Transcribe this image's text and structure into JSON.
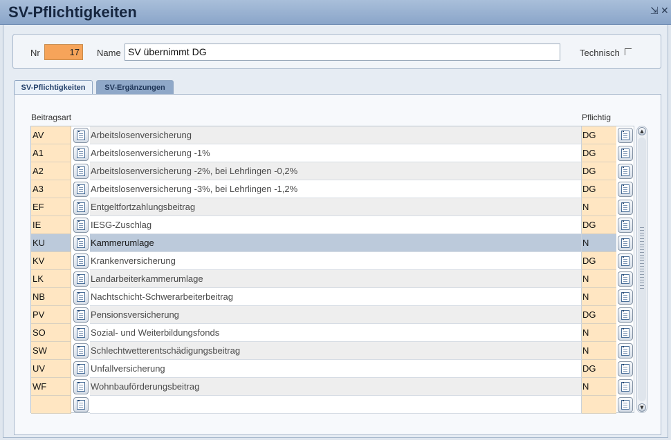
{
  "window": {
    "title": "SV-Pflichtigkeiten",
    "pin_glyph": "⇲",
    "close_glyph": "✕"
  },
  "header": {
    "nr_label": "Nr",
    "nr_value": "17",
    "name_label": "Name",
    "name_value": "SV übernimmt DG",
    "technisch_label": "Technisch",
    "technisch_checked": false
  },
  "tabs": [
    {
      "label": "SV-Pflichtigkeiten",
      "active": true
    },
    {
      "label": "SV-Ergänzungen",
      "active": false
    }
  ],
  "grid": {
    "col_beitragsart": "Beitragsart",
    "col_pflichtig": "Pflichtig",
    "rows": [
      {
        "code": "AV",
        "desc": "Arbeitslosenversicherung",
        "flag": "DG"
      },
      {
        "code": "A1",
        "desc": "Arbeitslosenversicherung -1%",
        "flag": "DG"
      },
      {
        "code": "A2",
        "desc": "Arbeitslosenversicherung -2%, bei Lehrlingen -0,2%",
        "flag": "DG"
      },
      {
        "code": "A3",
        "desc": "Arbeitslosenversicherung -3%, bei Lehrlingen -1,2%",
        "flag": "DG"
      },
      {
        "code": "EF",
        "desc": "Entgeltfortzahlungsbeitrag",
        "flag": "N"
      },
      {
        "code": "IE",
        "desc": "IESG-Zuschlag",
        "flag": "DG"
      },
      {
        "code": "KU",
        "desc": "Kammerumlage",
        "flag": "N"
      },
      {
        "code": "KV",
        "desc": "Krankenversicherung",
        "flag": "DG"
      },
      {
        "code": "LK",
        "desc": "Landarbeiterkammerumlage",
        "flag": "N"
      },
      {
        "code": "NB",
        "desc": "Nachtschicht-Schwerarbeiterbeitrag",
        "flag": "N"
      },
      {
        "code": "PV",
        "desc": "Pensionsversicherung",
        "flag": "DG"
      },
      {
        "code": "SO",
        "desc": "Sozial- und Weiterbildungsfonds",
        "flag": "N"
      },
      {
        "code": "SW",
        "desc": "Schlechtwetterentschädigungsbeitrag",
        "flag": "N"
      },
      {
        "code": "UV",
        "desc": "Unfallversicherung",
        "flag": "DG"
      },
      {
        "code": "WF",
        "desc": "Wohnbauförderungsbeitrag",
        "flag": "N"
      },
      {
        "code": "",
        "desc": "",
        "flag": ""
      }
    ],
    "selected_index": 6
  },
  "colors": {
    "titlebar": "#8aa5c9",
    "nr_field": "#f6a45a",
    "code_cell": "#ffe6c2",
    "selected_row": "#bccadb"
  },
  "icons": {
    "row_lookup": "document-list-icon",
    "scroll_up": "arrow-up-icon",
    "scroll_down": "arrow-down-icon"
  }
}
